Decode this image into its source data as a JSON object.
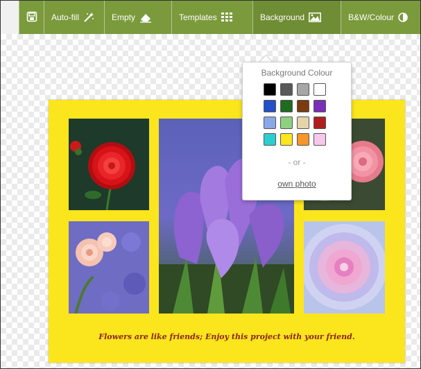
{
  "toolbar": {
    "autofill_label": "Auto-fill",
    "empty_label": "Empty",
    "templates_label": "Templates",
    "background_label": "Background",
    "bw_label": "B&W/Colour",
    "bar_color": "#7a9a3c"
  },
  "background_popup": {
    "title": "Background Colour",
    "swatches": [
      "#000000",
      "#595959",
      "#a6a6a6",
      "#ffffff",
      "#2450c8",
      "#1f6b1f",
      "#7a3b10",
      "#7a2fb7",
      "#8aa7e8",
      "#8fcf80",
      "#e6d3aa",
      "#b01e1e",
      "#2ccfcf",
      "#fbe51d",
      "#f5952a",
      "#f6c8ea"
    ],
    "or_text": "- or -",
    "own_photo_link": "own photo"
  },
  "collage": {
    "background_color": "#fbe51d",
    "caption": "Flowers are like friends; Enjoy this project with your friend.",
    "caption_color": "#8b2416"
  }
}
